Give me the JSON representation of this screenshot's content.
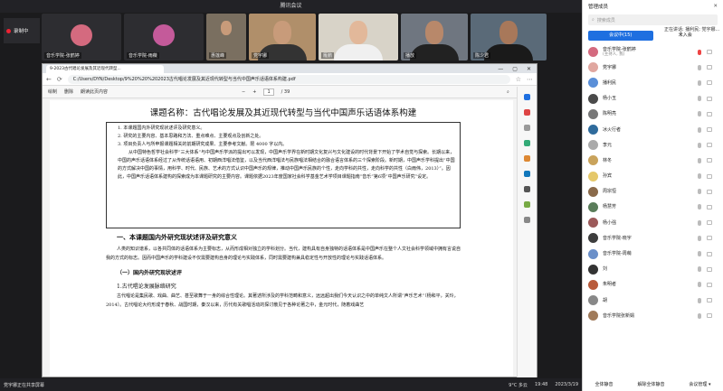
{
  "meeting": {
    "title": "腾讯会议",
    "record_label": "录制中"
  },
  "tiles": [
    {
      "name": "音乐学院-张鹤婷",
      "avatar": "#d46a7f"
    },
    {
      "name": "音乐学院-雨薇",
      "avatar": "#c45a9a"
    },
    {
      "name": "惠莲峰",
      "avatar": "#3a3a3a"
    },
    {
      "name": "党宇娜",
      "avatar": "#3a3a3a"
    },
    {
      "name": "雁鹏",
      "avatar": "#3a3a3a"
    },
    {
      "name": "播放",
      "avatar": "#3a3a3a"
    },
    {
      "name": "陈少君",
      "avatar": "#3a3a3a"
    }
  ],
  "browser": {
    "tab": "9-2023古代唱论发展及其近现代转型...",
    "url": "C:/Users/DYN/Desktop/9%20%20%202023古代唱论发展及其近现代转型与当代中国声乐话语体系构建.pdf",
    "win_min": "—",
    "win_max": "▢",
    "win_close": "✕",
    "pdf_tools": {
      "draw": "绘制",
      "erase": "删除",
      "read": "朗读此页内容",
      "page": "1",
      "total": "/ 39",
      "zoom_out": "−",
      "zoom_in": "+"
    }
  },
  "doc": {
    "title": "课题名称：古代唱论发展及其近现代转型与当代中国声乐话语体系构建",
    "box_items": [
      "1.  本课题国内外研究现状述评及研究意义。",
      "2.  研究的主要内容、基本思路和方法、重点难点、主要观点及创新之处。",
      "3.  项目负责人与所申报课题相关的前期研究成果、主要参考文献。限 4000 字以内。"
    ],
    "box_paras": [
      "从中国特色哲学社会科学“三大体系”与中国声乐学派的提出可以发现，中国声乐学界在新时期文化复兴与文化建设的时代背景下开始了学术自觉与探索。长期以来，中国的声乐话语体系经过了从传统话语语用、初期西洋唱法借鉴，以及当代西洋唱法与民族唱法相结合的融合语言体系的三个探索阶段。新时期，中国声乐学科提出“中国的方式解决中国的事情，用科学、时代、民族、艺术的方式认识中国声乐的规律，推动中国声乐民族的个性，走向学科的共性，走向科学的共性（白雨伟，2013）”。因此，中国声乐话语体系建构的探索成为本课题研究的主要内容。课题依据2023年度国家社会科学基金艺术学项目课题指南“音乐”第6项“中国声乐研究”设定。"
    ],
    "h1": "一、本课题国内外研究现状述评及研究意义",
    "para1": "人类的知识谱系，以各共同体的话语体系为主要标志，从而形成相对独立的学科划分。当代，建构具有自身独特的话语体系是中国声乐在整个人文社会科学领域中拥有言说自我的方式的标志。因而中国声乐的学科建设不仅需要建构自身的理论与实践体系，同时需要建构兼具稳定性与开放性的理论与实践话语体系。",
    "h2": "（一）国内外研究现状述评",
    "h3": "1.古代唱论发展脉络研究",
    "para2": "古代唱论是集民歌、戏曲、曲艺、甚至歌舞于一身的综合性理论。其著述所涉及的学科范畴和意义，远远超出我们今天认识之中的单纯文人所谓“声乐艺术”（杨和平，关玲，2014）。古代唱论大约形成于春秋、战国时期，秦汉以来，历代有关歌唱活动的探讨散见于各种论著之中，金元时代，随着戏曲艺"
  },
  "taskbar": {
    "weather": "9°C 多云",
    "time": "19:48",
    "date": "2023/3/19",
    "left": "党宇娜正在共享屏幕"
  },
  "members": {
    "header": "管理成员",
    "search_placeholder": "搜索成员",
    "speaking": "正在讲话: 播利民; 党宇娜...",
    "tabs": [
      "会议中(15)",
      "未入会"
    ],
    "list": [
      {
        "name": "音乐学院-张鹤婷",
        "sub": "(主持人, 我)",
        "color": "#d46a7f",
        "mic": "red"
      },
      {
        "name": "党宇娜",
        "sub": "",
        "color": "#e0a7a0",
        "mic": "grey"
      },
      {
        "name": "播利民",
        "sub": "",
        "color": "#5a8fd8",
        "mic": "grey"
      },
      {
        "name": "杨小玉",
        "sub": "",
        "color": "#4a4a4a",
        "mic": "grey"
      },
      {
        "name": "陈明亮",
        "sub": "",
        "color": "#777",
        "mic": "grey"
      },
      {
        "name": "冰火行者",
        "sub": "",
        "color": "#2f6b9c",
        "mic": "grey"
      },
      {
        "name": "李元",
        "sub": "",
        "color": "#aaa",
        "mic": "grey"
      },
      {
        "name": "林冬",
        "sub": "",
        "color": "#c9a35c",
        "mic": "grey"
      },
      {
        "name": "孙宾",
        "sub": "",
        "color": "#e5c86a",
        "mic": "grey"
      },
      {
        "name": "周宗恒",
        "sub": "",
        "color": "#8a6a4a",
        "mic": "grey"
      },
      {
        "name": "杨慧芳",
        "sub": "",
        "color": "#5a7d5a",
        "mic": "grey"
      },
      {
        "name": "杨小强",
        "sub": "",
        "color": "#9c5a5a",
        "mic": "grey"
      },
      {
        "name": "音乐学院-晓宇",
        "sub": "",
        "color": "#3d3d3d",
        "mic": "grey"
      },
      {
        "name": "音乐学院-周萌",
        "sub": "",
        "color": "#6a8fc9",
        "mic": "grey"
      },
      {
        "name": "刘",
        "sub": "",
        "color": "#333",
        "mic": "grey"
      },
      {
        "name": "朱明者",
        "sub": "",
        "color": "#b85a3a",
        "mic": "grey"
      },
      {
        "name": "胡",
        "sub": "",
        "color": "#888",
        "mic": "grey"
      },
      {
        "name": "音乐学院张新娟",
        "sub": "",
        "color": "#a07a5a",
        "mic": "grey"
      }
    ],
    "footer": [
      "全体静音",
      "解除全体静音",
      "会议管理 ▾"
    ]
  }
}
